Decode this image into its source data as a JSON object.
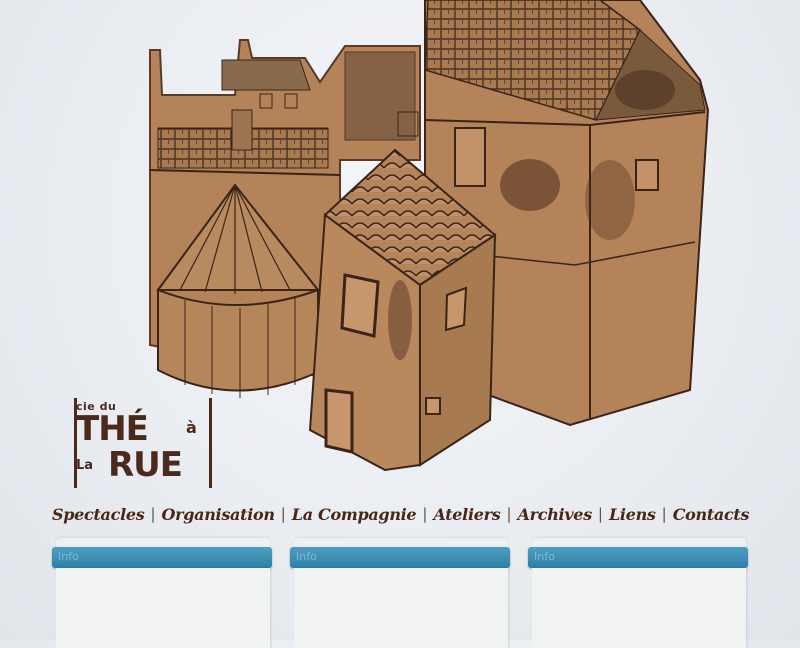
{
  "brand": {
    "line1": "cie du",
    "line2": "THÉ",
    "line3": "à",
    "line4": "La",
    "line5": "RUE",
    "color": "#4b2a1c"
  },
  "nav": {
    "items": [
      {
        "label": "Spectacles"
      },
      {
        "label": "Organisation"
      },
      {
        "label": "La Compagnie"
      },
      {
        "label": "Ateliers"
      },
      {
        "label": "Archives"
      },
      {
        "label": "Liens"
      },
      {
        "label": "Contacts"
      }
    ],
    "separator": "|",
    "color": "#4a2616"
  },
  "panels": [
    {
      "title": "Info"
    },
    {
      "title": "Info"
    },
    {
      "title": "Info"
    }
  ],
  "colors": {
    "cardboard": "#b88458",
    "ink": "#3a2418",
    "panel_bar": "#3a8ab2",
    "background": "#eceff3"
  }
}
